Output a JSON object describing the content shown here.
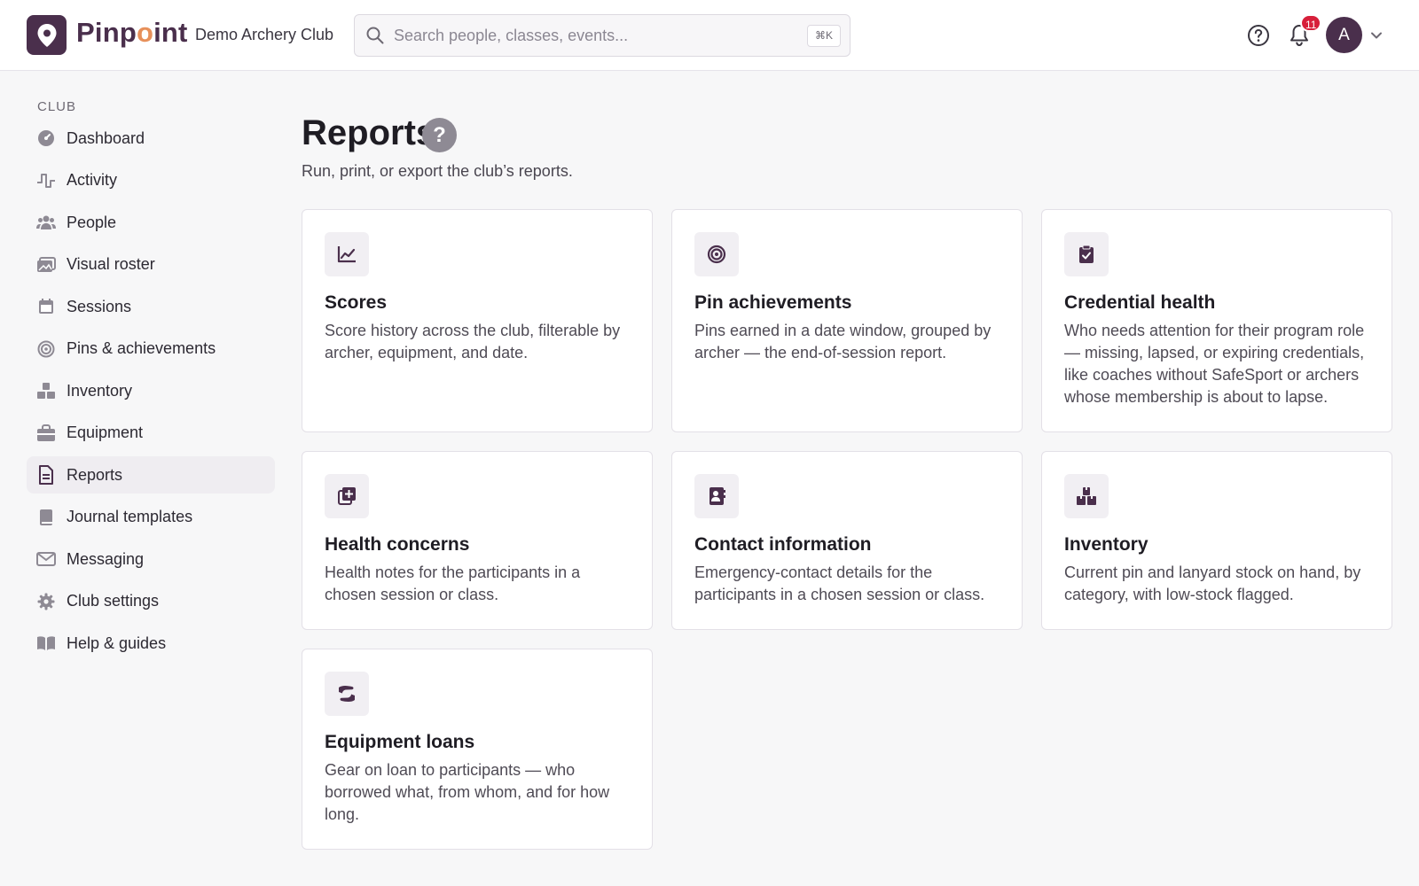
{
  "header": {
    "brand_prefix": "Pinp",
    "brand_accent": "o",
    "brand_suffix": "int",
    "club_name": "Demo Archery Club",
    "search_placeholder": "Search people, classes, events...",
    "search_shortcut": "⌘K",
    "notification_count": "11",
    "avatar_initial": "A"
  },
  "colors": {
    "brand": "#4a2f4c",
    "accent": "#e7905a",
    "badge": "#d71f3a"
  },
  "sidebar": {
    "section_label": "CLUB",
    "items": [
      {
        "label": "Dashboard",
        "icon": "dashboard-icon",
        "active": false
      },
      {
        "label": "Activity",
        "icon": "activity-icon",
        "active": false
      },
      {
        "label": "People",
        "icon": "people-icon",
        "active": false
      },
      {
        "label": "Visual roster",
        "icon": "photos-icon",
        "active": false
      },
      {
        "label": "Sessions",
        "icon": "calendar-icon",
        "active": false
      },
      {
        "label": "Pins & achievements",
        "icon": "target-icon",
        "active": false
      },
      {
        "label": "Inventory",
        "icon": "boxes-icon",
        "active": false
      },
      {
        "label": "Equipment",
        "icon": "toolbox-icon",
        "active": false
      },
      {
        "label": "Reports",
        "icon": "document-icon",
        "active": true
      },
      {
        "label": "Journal templates",
        "icon": "book-icon",
        "active": false
      },
      {
        "label": "Messaging",
        "icon": "envelope-icon",
        "active": false
      },
      {
        "label": "Club settings",
        "icon": "gear-icon",
        "active": false
      },
      {
        "label": "Help & guides",
        "icon": "open-book-icon",
        "active": false
      }
    ]
  },
  "main": {
    "title": "Reports",
    "help_glyph": "?",
    "subtitle": "Run, print, or export the club’s reports.",
    "cards": [
      {
        "title": "Scores",
        "icon": "line-chart-icon",
        "description": "Score history across the club, filterable by archer, equipment, and date."
      },
      {
        "title": "Pin achievements",
        "icon": "target-icon",
        "description": "Pins earned in a date window, grouped by archer — the end-of-session report."
      },
      {
        "title": "Credential health",
        "icon": "clipboard-check-icon",
        "description": "Who needs attention for their program role — missing, lapsed, or expiring credentials, like coaches without SafeSport or archers whose membership is about to lapse."
      },
      {
        "title": "Health concerns",
        "icon": "medical-notes-icon",
        "description": "Health notes for the participants in a chosen session or class."
      },
      {
        "title": "Contact information",
        "icon": "address-book-icon",
        "description": "Emergency-contact details for the participants in a chosen session or class."
      },
      {
        "title": "Inventory",
        "icon": "boxes-icon",
        "description": "Current pin and lanyard stock on hand, by category, with low-stock flagged."
      },
      {
        "title": "Equipment loans",
        "icon": "hand-holding-icon",
        "description": "Gear on loan to participants — who borrowed what, from whom, and for how long."
      }
    ]
  }
}
